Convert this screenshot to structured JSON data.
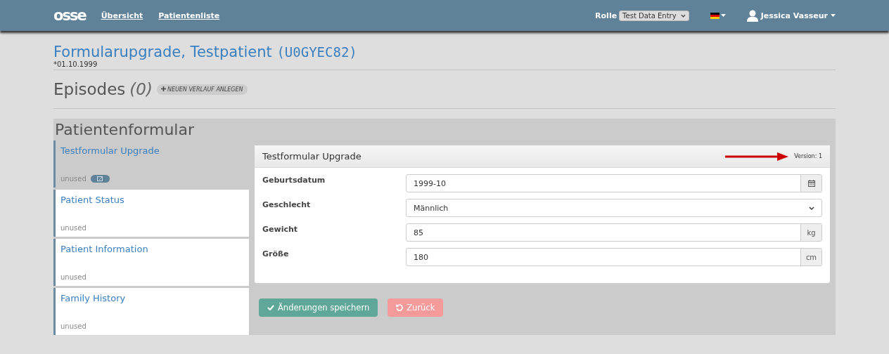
{
  "navbar": {
    "logo": "osse",
    "links": [
      "Übersicht",
      "Patientenliste"
    ],
    "role_label": "Rolle",
    "role_value": "Test Data Entry",
    "user": "Jessica Vasseur"
  },
  "patient": {
    "name": "Formularupgrade, Testpatient",
    "id": "(U0GYEC82)",
    "birth": "*01.10.1999"
  },
  "episodes": {
    "title": "Episodes",
    "count": "(0)",
    "button": "NEUEN VERLAUF ANLEGEN"
  },
  "section_title": "Patientenformular",
  "forms": [
    {
      "title": "Testformular Upgrade",
      "status": "unused",
      "selected": true
    },
    {
      "title": "Patient Status",
      "status": "unused",
      "selected": false
    },
    {
      "title": "Patient Information",
      "status": "unused",
      "selected": false
    },
    {
      "title": "Family History",
      "status": "unused",
      "selected": false
    }
  ],
  "panel": {
    "title": "Testformular Upgrade",
    "version": "Version: 1",
    "fields": [
      {
        "label": "Geburtsdatum",
        "value": "1999-10",
        "kind": "date"
      },
      {
        "label": "Geschlecht",
        "value": "Männlich",
        "kind": "select"
      },
      {
        "label": "Gewicht",
        "value": "85",
        "kind": "unit",
        "unit": "kg"
      },
      {
        "label": "Größe",
        "value": "180",
        "kind": "unit",
        "unit": "cm"
      }
    ]
  },
  "buttons": {
    "save": "Änderungen speichern",
    "back": "Zurück"
  }
}
